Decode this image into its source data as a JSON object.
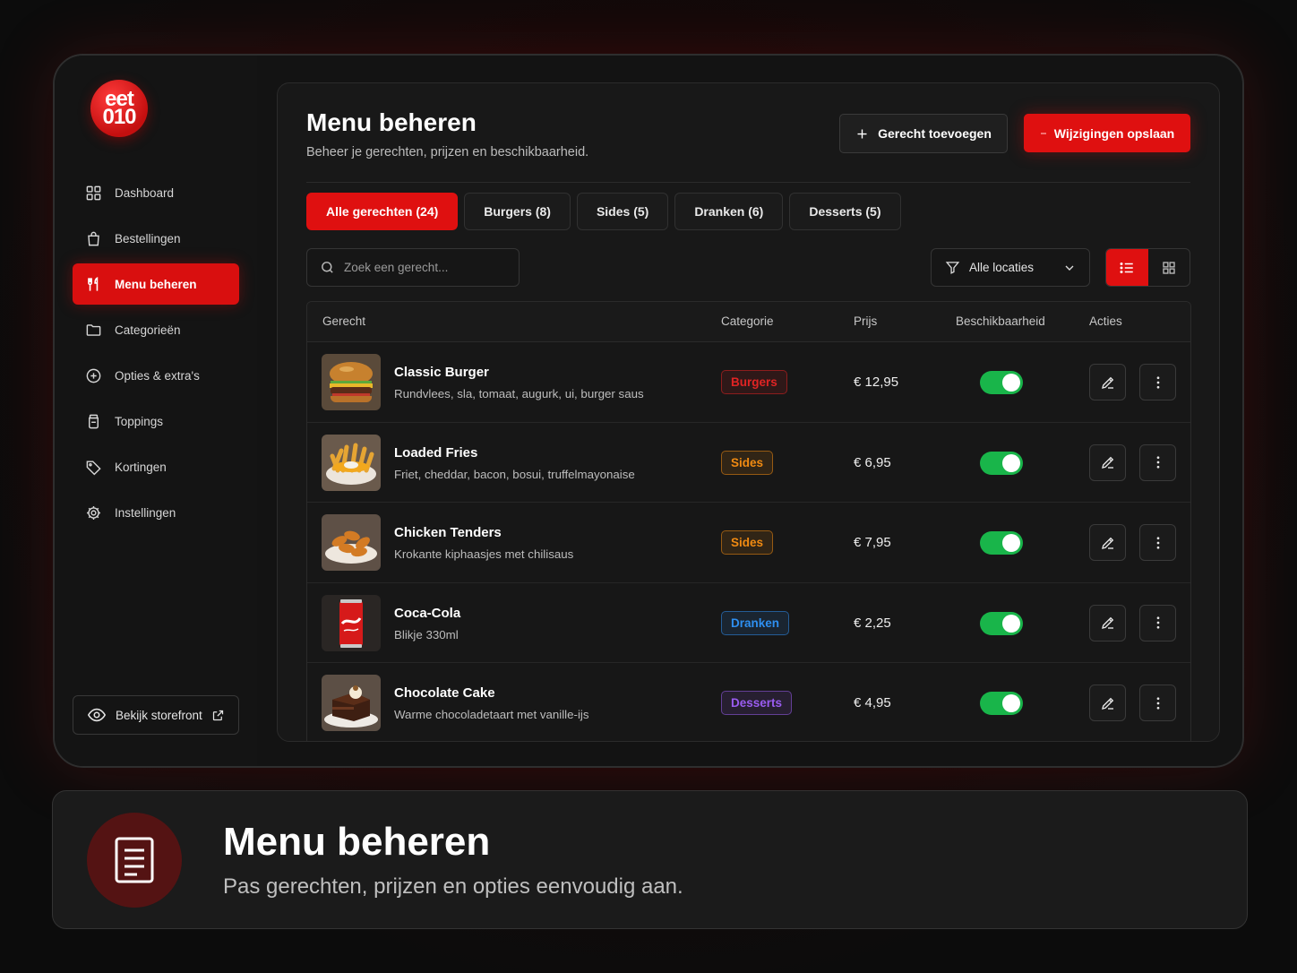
{
  "brand": {
    "logo_line1": "eet",
    "logo_line2": "010",
    "accent": "#df1010"
  },
  "sidebar": {
    "items": [
      {
        "label": "Dashboard",
        "icon": "dashboard-icon",
        "active": false
      },
      {
        "label": "Bestellingen",
        "icon": "shopping-bag-icon",
        "active": false
      },
      {
        "label": "Menu beheren",
        "icon": "fork-knife-icon",
        "active": true
      },
      {
        "label": "Categorieën",
        "icon": "folder-icon",
        "active": false
      },
      {
        "label": "Opties & extra's",
        "icon": "plus-circle-icon",
        "active": false
      },
      {
        "label": "Toppings",
        "icon": "jar-icon",
        "active": false
      },
      {
        "label": "Kortingen",
        "icon": "tag-icon",
        "active": false
      },
      {
        "label": "Instellingen",
        "icon": "gear-icon",
        "active": false
      }
    ],
    "storefront_label": "Bekijk storefront"
  },
  "header": {
    "title": "Menu beheren",
    "subtitle": "Beheer je gerechten, prijzen en beschikbaarheid.",
    "add_label": "Gerecht toevoegen",
    "save_label": "Wijzigingen opslaan"
  },
  "tabs": [
    {
      "label": "Alle gerechten (24)",
      "active": true
    },
    {
      "label": "Burgers (8)",
      "active": false
    },
    {
      "label": "Sides (5)",
      "active": false
    },
    {
      "label": "Dranken (6)",
      "active": false
    },
    {
      "label": "Desserts (5)",
      "active": false
    }
  ],
  "search": {
    "placeholder": "Zoek een gerecht..."
  },
  "location_filter": {
    "value": "Alle locaties"
  },
  "table": {
    "columns": {
      "dish": "Gerecht",
      "category": "Categorie",
      "price": "Prijs",
      "availability": "Beschikbaarheid",
      "actions": "Acties"
    },
    "rows": [
      {
        "name": "Classic Burger",
        "description": "Rundvlees, sla, tomaat, augurk, ui, burger saus",
        "category": "Burgers",
        "category_color": "#e02424",
        "price": "€ 12,95",
        "available": true,
        "image": "burger"
      },
      {
        "name": "Loaded Fries",
        "description": "Friet, cheddar, bacon, bosui, truffelmayonaise",
        "category": "Sides",
        "category_color": "#f08a12",
        "price": "€ 6,95",
        "available": true,
        "image": "fries"
      },
      {
        "name": "Chicken Tenders",
        "description": "Krokante kiphaasjes met chilisaus",
        "category": "Sides",
        "category_color": "#f08a12",
        "price": "€ 7,95",
        "available": true,
        "image": "tenders"
      },
      {
        "name": "Coca-Cola",
        "description": "Blikje 330ml",
        "category": "Dranken",
        "category_color": "#2e8ff0",
        "price": "€ 2,25",
        "available": true,
        "image": "cola"
      },
      {
        "name": "Chocolate Cake",
        "description": "Warme chocoladetaart met vanille-ijs",
        "category": "Desserts",
        "category_color": "#9a5cf0",
        "price": "€ 4,95",
        "available": true,
        "image": "cake"
      }
    ]
  },
  "caption": {
    "title": "Menu beheren",
    "subtitle": "Pas gerechten, prijzen en opties eenvoudig aan."
  }
}
